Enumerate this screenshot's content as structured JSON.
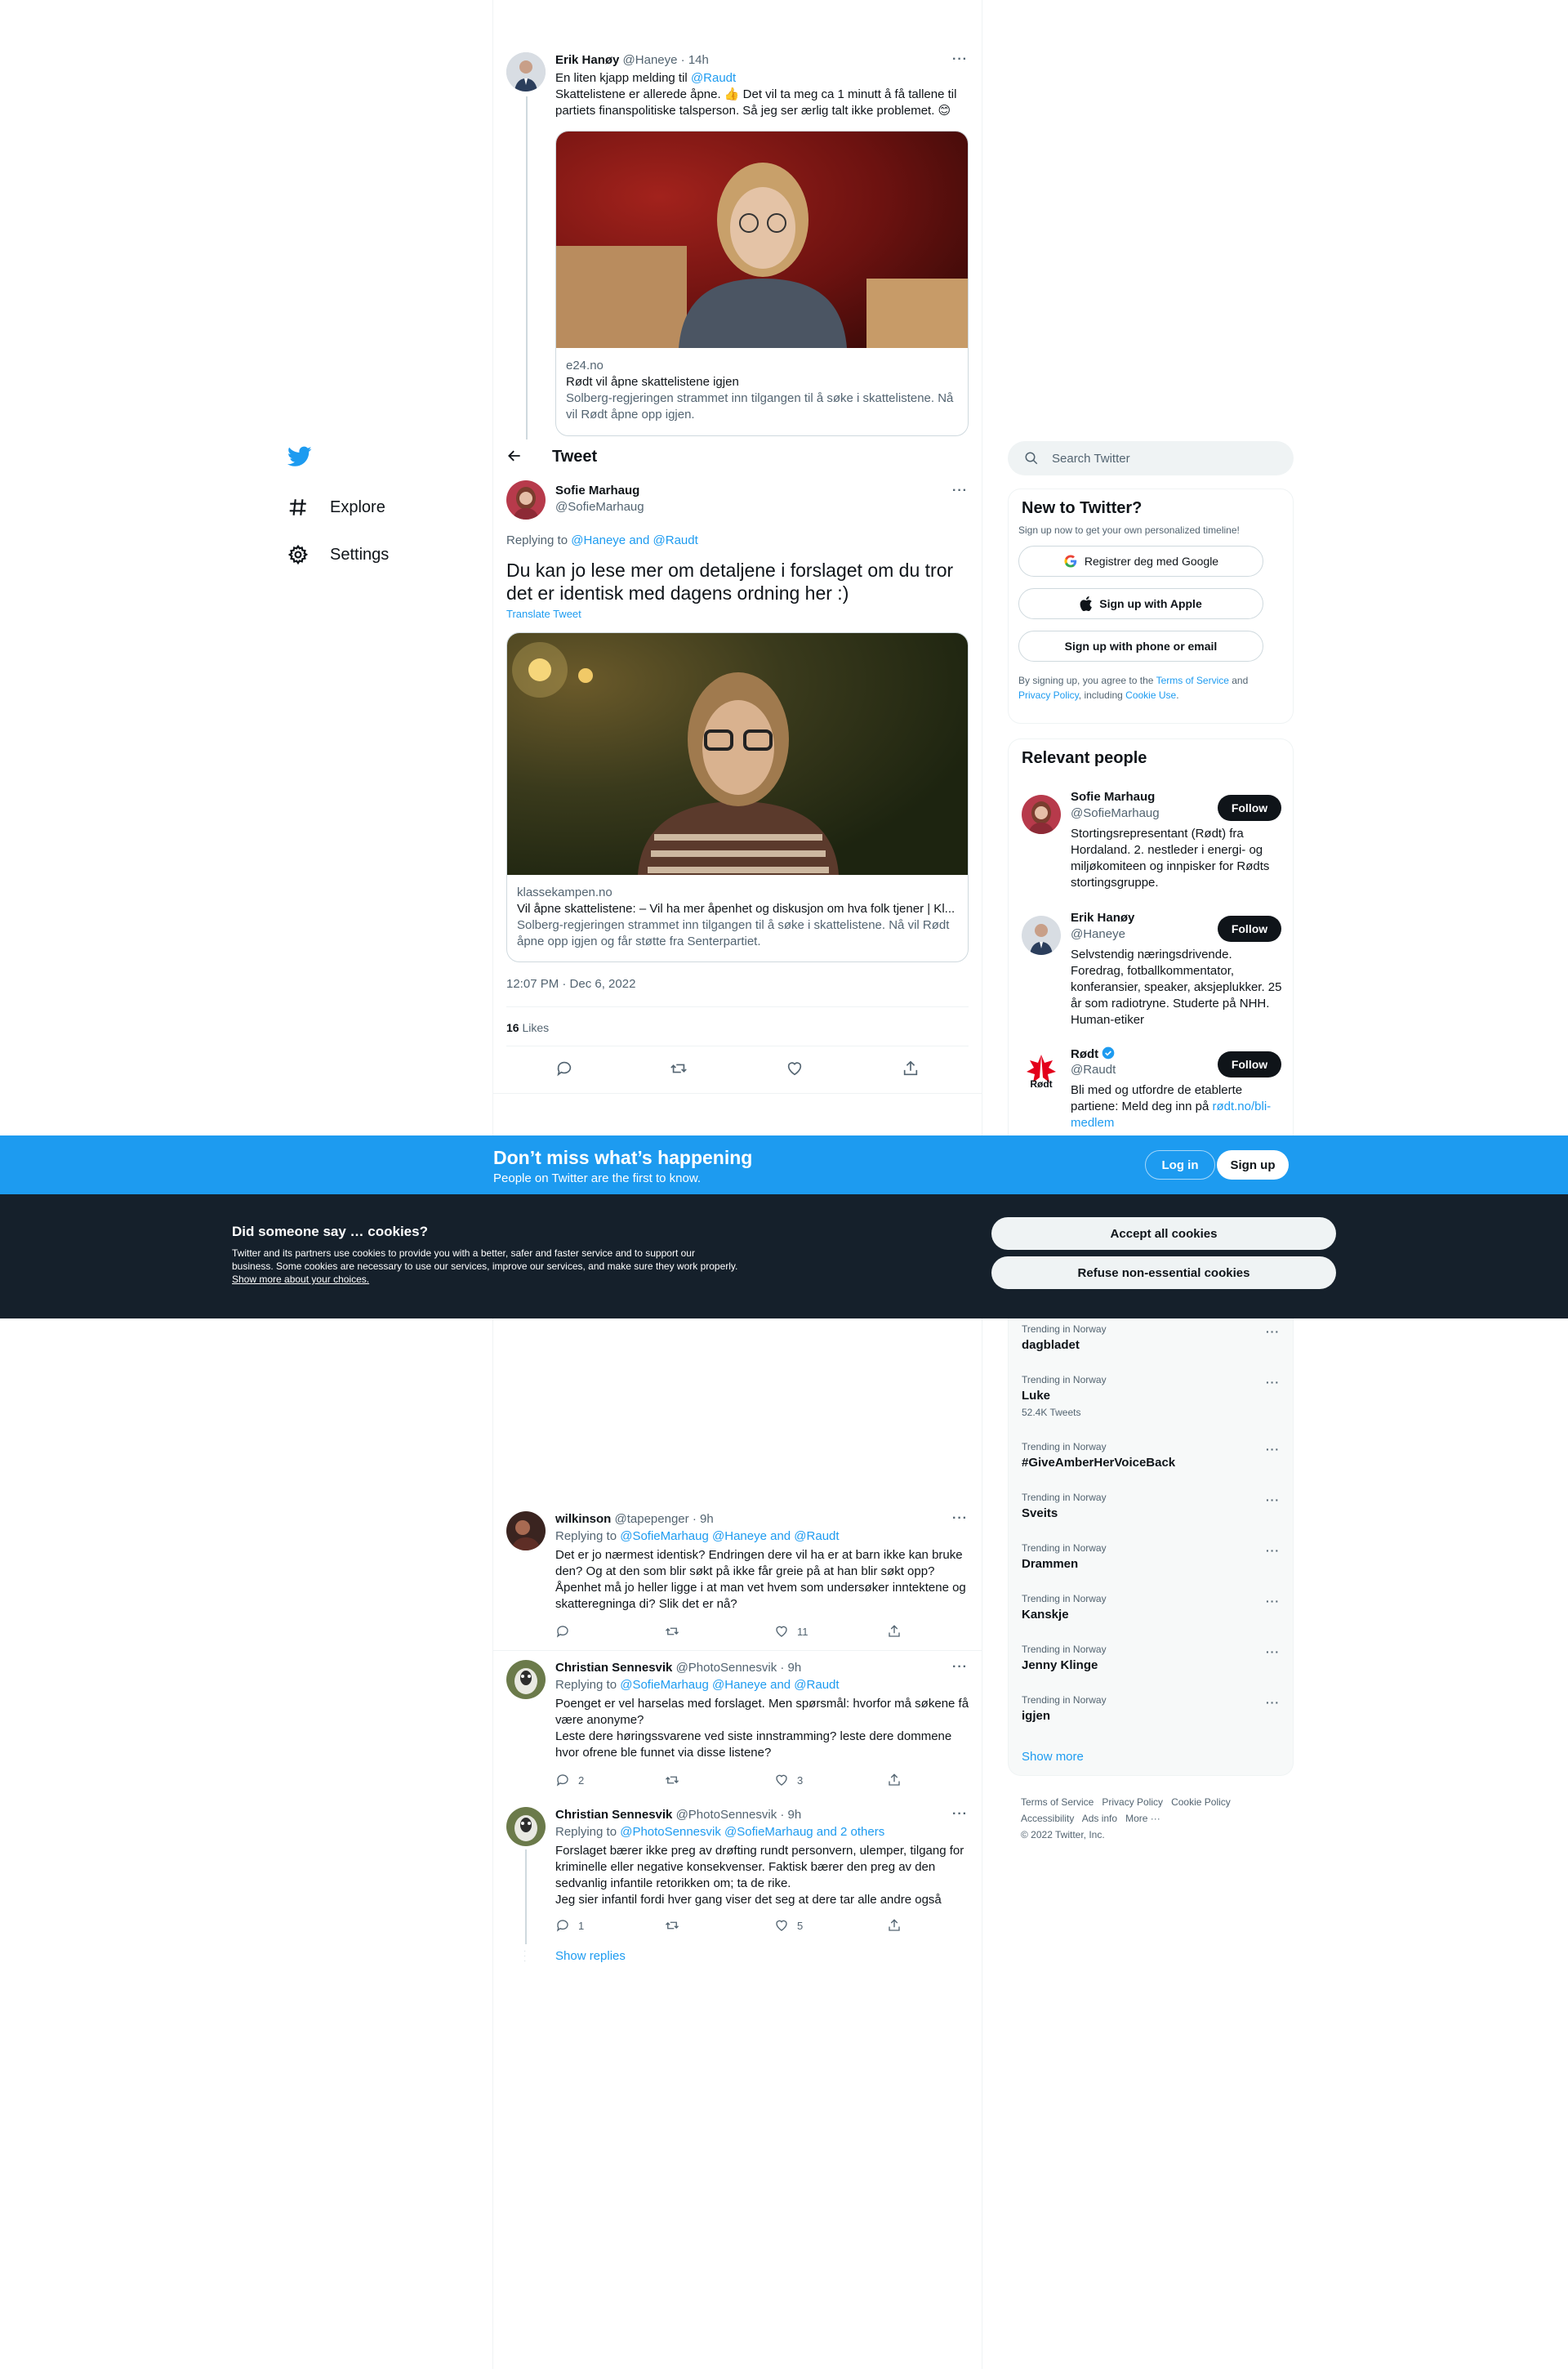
{
  "nav": {
    "explore": "Explore",
    "settings": "Settings"
  },
  "header": {
    "title": "Tweet"
  },
  "parent_tweet": {
    "name": "Erik Hanøy",
    "handle": "@Haneye",
    "time": "· 14h",
    "line1_prefix": "En liten kjapp melding til ",
    "line1_mention": "@Raudt",
    "line2": "Skattelistene er allerede åpne. 👍 Det vil ta meg ca 1 minutt å få tallene til",
    "line3": "partiets finanspolitiske talsperson. Så jeg ser ærlig talt ikke problemet. 😊",
    "card": {
      "domain": "e24.no",
      "title": "Rødt vil åpne skattelistene igjen",
      "desc": "Solberg-regjeringen strammet inn tilgangen til å søke i skattelistene. Nå vil Rødt åpne opp igjen."
    }
  },
  "main_tweet": {
    "name": "Sofie Marhaug",
    "handle": "@SofieMarhaug",
    "replying_prefix": "Replying to ",
    "replying_mentions": "@Haneye and @Raudt",
    "text": "Du kan jo lese mer om detaljene i forslaget om du tror det er identisk med dagens ordning her :)",
    "translate": "Translate Tweet",
    "card": {
      "domain": "klassekampen.no",
      "title": "Vil åpne skattelistene: – Vil ha mer åpenhet og diskusjon om hva folk tjener | Kl...",
      "desc": "Solberg-regjeringen strammet inn tilgangen til å søke i skattelistene. Nå vil Rødt åpne opp igjen og får støtte fra Senterpartiet."
    },
    "timestamp": "12:07 PM · Dec 6, 2022",
    "likes_count": "16",
    "likes_label": "Likes"
  },
  "replies": [
    {
      "name": "wilkinson",
      "handle": "@tapepenger",
      "time": "· 9h",
      "replying_prefix": "Replying to ",
      "replying_mentions": "@SofieMarhaug @Haneye and @Raudt",
      "lines": [
        "Det er jo nærmest identisk? Endringen dere vil ha er at barn ikke kan bruke",
        "den? Og at den som blir søkt på ikke får greie på at han blir søkt opp?",
        "Åpenhet må jo heller ligge i at man vet hvem som undersøker inntektene og",
        "skatteregninga di? Slik det er nå?"
      ],
      "reply_count": "",
      "retweet_count": "",
      "like_count": "11"
    },
    {
      "name": "Christian Sennesvik",
      "handle": "@PhotoSennesvik",
      "time": "· 9h",
      "replying_prefix": "Replying to ",
      "replying_mentions": "@SofieMarhaug @Haneye and @Raudt",
      "lines": [
        "Poenget er vel harselas med forslaget. Men spørsmål: hvorfor må søkene få",
        "være anonyme?",
        "Leste dere høringssvarene ved siste innstramming? leste dere dommene",
        "hvor ofrene ble funnet via disse listene?"
      ],
      "reply_count": "2",
      "retweet_count": "",
      "like_count": "3"
    },
    {
      "name": "Christian Sennesvik",
      "handle": "@PhotoSennesvik",
      "time": "· 9h",
      "replying_prefix": "Replying to ",
      "replying_mentions": "@PhotoSennesvik @SofieMarhaug and 2 others",
      "lines": [
        "Forslaget bærer ikke preg av drøfting rundt personvern, ulemper, tilgang for",
        "kriminelle eller negative konsekvenser. Faktisk bærer den preg av den",
        "sedvanlig infantile retorikken om; ta de rike.",
        "Jeg sier infantil fordi hver gang viser det seg at dere tar alle andre også"
      ],
      "reply_count": "1",
      "retweet_count": "",
      "like_count": "5"
    }
  ],
  "show_replies": "Show replies",
  "right": {
    "search_placeholder": "Search Twitter",
    "new_title": "New to Twitter?",
    "new_sub": "Sign up now to get your own personalized timeline!",
    "google_btn": "Registrer deg med Google",
    "apple_btn": "Sign up with Apple",
    "phone_btn": "Sign up with phone or email",
    "terms_1": "By signing up, you agree to the ",
    "terms_tos": "Terms of Service",
    "terms_and": " and",
    "terms_privacy": "Privacy Policy",
    "terms_including": ", including ",
    "terms_cookie": "Cookie Use",
    "terms_end": ".",
    "relevant_title": "Relevant people",
    "follow": "Follow",
    "people": [
      {
        "name": "Sofie Marhaug",
        "handle": "@SofieMarhaug",
        "bio": "Stortingsrepresentant (Rødt) fra Hordaland. 2. nestleder i energi- og miljøkomiteen og innpisker for Rødts stortingsgruppe."
      },
      {
        "name": "Erik Hanøy",
        "handle": "@Haneye",
        "bio": "Selvstendig næringsdrivende. Foredrag, fotballkommentator, konferansier, speaker, aksjeplukker. 25 år som radiotryne. Studerte på NHH. Human-etiker"
      },
      {
        "name": "Rødt",
        "handle": "@Raudt",
        "bio_prefix": "Bli med og utfordre de etablerte partiene: Meld deg inn på ",
        "bio_link": "rødt.no/bli-medlem"
      }
    ],
    "trend_cat": "Trending in Norway",
    "trends": [
      {
        "name": "dagbladet",
        "count": ""
      },
      {
        "name": "Luke",
        "count": "52.4K Tweets"
      },
      {
        "name": "#GiveAmberHerVoiceBack",
        "count": ""
      },
      {
        "name": "Sveits",
        "count": ""
      },
      {
        "name": "Drammen",
        "count": ""
      },
      {
        "name": "Kanskje",
        "count": ""
      },
      {
        "name": "Jenny Klinge",
        "count": ""
      },
      {
        "name": "igjen",
        "count": ""
      }
    ],
    "show_more": "Show more",
    "footer": {
      "tos": "Terms of Service",
      "privacy": "Privacy Policy",
      "cookie": "Cookie Policy",
      "accessibility": "Accessibility",
      "ads": "Ads info",
      "more": "More ···",
      "copyright": "© 2022 Twitter, Inc."
    }
  },
  "banner": {
    "title": "Don’t miss what’s happening",
    "sub": "People on Twitter are the first to know.",
    "login": "Log in",
    "signup": "Sign up"
  },
  "cookies": {
    "title": "Did someone say … cookies?",
    "body": "Twitter and its partners use cookies to provide you with a better, safer and faster service and to support our business. Some cookies are necessary to use our services, improve our services, and make sure they work properly. ",
    "link": "Show more about your choices.",
    "accept": "Accept all cookies",
    "refuse": "Refuse non-essential cookies"
  },
  "colors": {
    "accent": "#1d9bf0",
    "dark": "#15202b",
    "text": "#0f1419",
    "secondary": "#536471"
  }
}
